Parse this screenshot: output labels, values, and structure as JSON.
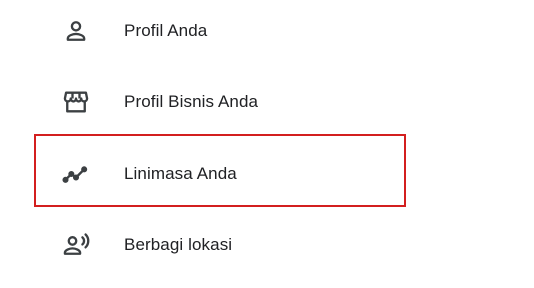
{
  "menu": {
    "items": [
      {
        "label": "Profil Anda",
        "icon": "person-outline-icon"
      },
      {
        "label": "Profil Bisnis Anda",
        "icon": "storefront-icon"
      },
      {
        "label": "Linimasa Anda",
        "icon": "timeline-icon",
        "highlighted": true
      },
      {
        "label": "Berbagi lokasi",
        "icon": "share-location-person-icon"
      }
    ]
  },
  "colors": {
    "icon": "#3c4043",
    "text": "#202124",
    "highlight_border": "#d31f1f",
    "background": "#ffffff"
  }
}
